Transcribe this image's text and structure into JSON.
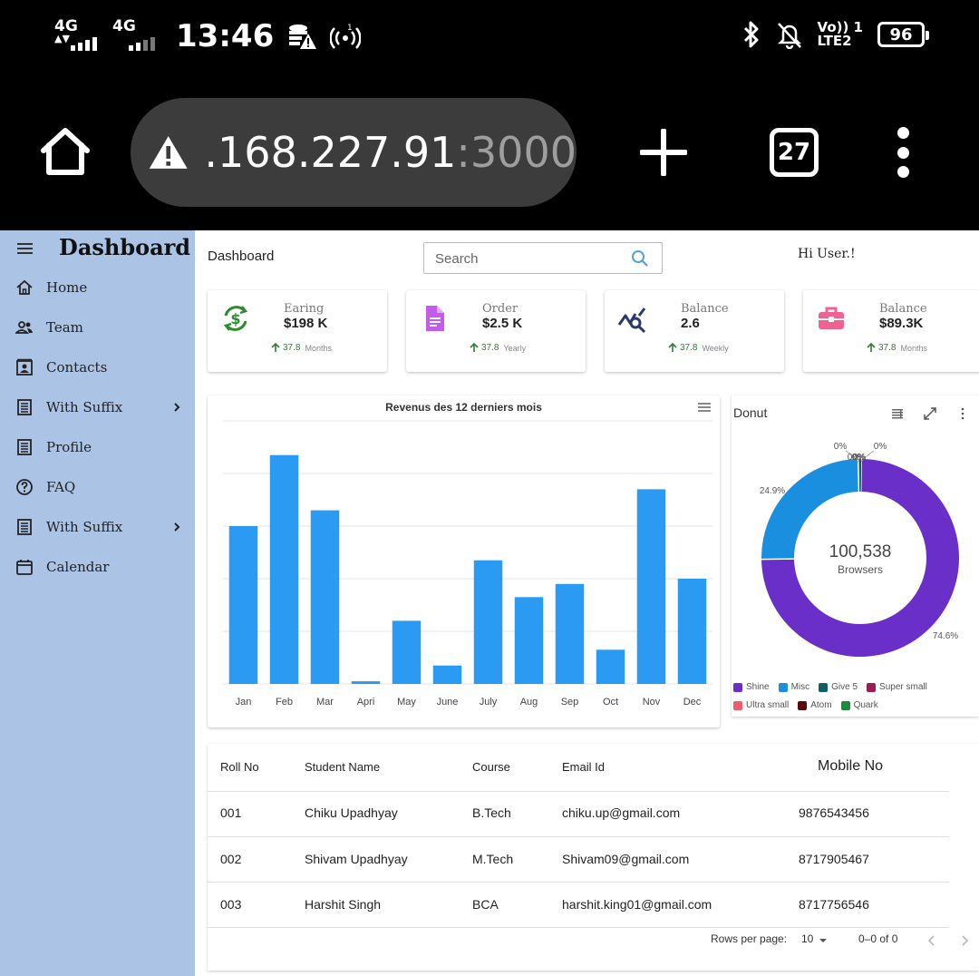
{
  "status_bar": {
    "net1": "4G",
    "net2": "4G",
    "time": "13:46",
    "volte": "Vo)) 1",
    "lte": "LTE2",
    "battery": "96"
  },
  "browser": {
    "url_host": ".168.227.91",
    "url_port": ":3000",
    "tab_count": "27"
  },
  "sidebar": {
    "title": "Dashboard",
    "items": [
      {
        "label": "Home",
        "icon": "home-icon"
      },
      {
        "label": "Team",
        "icon": "team-icon"
      },
      {
        "label": "Contacts",
        "icon": "contacts-icon"
      },
      {
        "label": "With Suffix",
        "icon": "list-icon",
        "has_chevron": true
      },
      {
        "label": "Profile",
        "icon": "list-icon"
      },
      {
        "label": "FAQ",
        "icon": "help-icon"
      },
      {
        "label": "With Suffix",
        "icon": "list-icon",
        "has_chevron": true
      },
      {
        "label": "Calendar",
        "icon": "calendar-icon"
      }
    ]
  },
  "header": {
    "breadcrumb": "Dashboard",
    "search_placeholder": "Search",
    "greeting": "Hi User.!"
  },
  "stats": [
    {
      "label": "Earing",
      "value": "$198 K",
      "trend": "37.8",
      "period": "Months",
      "icon": "dollar-cycle-icon",
      "color": "#2e8b2e"
    },
    {
      "label": "Order",
      "value": "$2.5 K",
      "trend": "37.8",
      "period": "Yearly",
      "icon": "document-icon",
      "color": "#c35ce8"
    },
    {
      "label": "Balance",
      "value": "2.6",
      "trend": "37.8",
      "period": "Weekly",
      "icon": "analytics-icon",
      "color": "#2a3a70"
    },
    {
      "label": "Balance",
      "value": "$89.3K",
      "trend": "37.8",
      "period": "Months",
      "icon": "briefcase-icon",
      "color": "#f06292"
    }
  ],
  "chart_data": [
    {
      "type": "bar",
      "title": "Revenus des 12 derniers mois",
      "categories": [
        "Jan",
        "Feb",
        "Mar",
        "Apri",
        "May",
        "June",
        "July",
        "Aug",
        "Sep",
        "Oct",
        "Nov",
        "Dec"
      ],
      "values": [
        60,
        87,
        66,
        1,
        24,
        7,
        47,
        33,
        38,
        13,
        74,
        40
      ],
      "ylim": [
        0,
        100
      ],
      "grid": true,
      "color": "#2b9af3"
    },
    {
      "type": "pie",
      "title": "Donut",
      "center_value": "100,538",
      "center_label": "Browsers",
      "slices": [
        {
          "name": "Shine",
          "value": 74.6,
          "label": "74.6%",
          "color": "#6a2ec9"
        },
        {
          "name": "Misc",
          "value": 24.9,
          "label": "24.9%",
          "color": "#1a8fe0"
        },
        {
          "name": "Give 5",
          "value": 0.5,
          "label": "0%",
          "color": "#0f5f63"
        },
        {
          "name": "Super small",
          "value": 0.0,
          "label": "0%",
          "color": "#9c1c52"
        },
        {
          "name": "Ultra small",
          "value": 0.0,
          "label": "0%",
          "color": "#f25c6a"
        },
        {
          "name": "Atom",
          "value": 0.0,
          "label": "0%",
          "color": "#5a0a0a"
        },
        {
          "name": "Quark",
          "value": 0.0,
          "label": "0%",
          "color": "#1e8a3c"
        }
      ]
    }
  ],
  "table": {
    "columns": [
      "Roll No",
      "Student Name",
      "Course",
      "Email Id",
      "Mobile No"
    ],
    "rows": [
      [
        "001",
        "Chiku Upadhyay",
        "B.Tech",
        "chiku.up@gmail.com",
        "9876543456"
      ],
      [
        "002",
        "Shivam Upadhyay",
        "M.Tech",
        "Shivam09@gmail.com",
        "8717905467"
      ],
      [
        "003",
        "Harshit Singh",
        "BCA",
        "harshit.king01@gmail.com",
        "8717756546"
      ]
    ],
    "rows_per_page_label": "Rows per page:",
    "rows_per_page_value": "10",
    "range": "0–0 of 0"
  }
}
